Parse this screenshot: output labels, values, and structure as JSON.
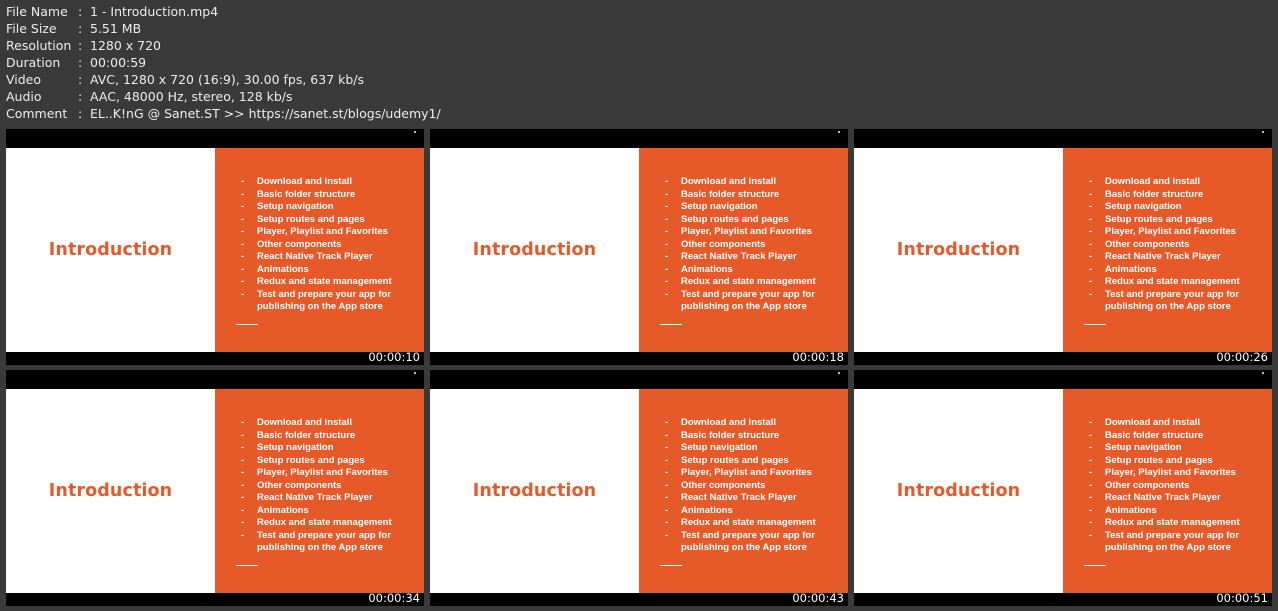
{
  "info": [
    {
      "key": "File Name",
      "value": "1 - Introduction.mp4"
    },
    {
      "key": "File Size",
      "value": "5.51 MB"
    },
    {
      "key": "Resolution",
      "value": "1280 x 720"
    },
    {
      "key": "Duration",
      "value": "00:00:59"
    },
    {
      "key": "Video",
      "value": "AVC, 1280 x 720 (16:9), 30.00 fps, 637 kb/s"
    },
    {
      "key": "Audio",
      "value": "AAC, 48000 Hz, stereo, 128 kb/s"
    },
    {
      "key": "Comment",
      "value": "EL..K!nG @ Sanet.ST >> https://sanet.st/blogs/udemy1/"
    }
  ],
  "separator": ":",
  "slide": {
    "title": "Introduction",
    "bullet": "-",
    "topics": [
      "Download and install",
      "Basic folder structure",
      "Setup navigation",
      "Setup routes and pages",
      "Player, Playlist and Favorites",
      "Other components",
      "React Native Track Player",
      "Animations",
      "Redux and state management",
      "Test and prepare your app for publishing on the App store"
    ]
  },
  "thumbnails": [
    {
      "timestamp": "00:00:10"
    },
    {
      "timestamp": "00:00:18"
    },
    {
      "timestamp": "00:00:26"
    },
    {
      "timestamp": "00:00:34"
    },
    {
      "timestamp": "00:00:43"
    },
    {
      "timestamp": "00:00:51"
    }
  ],
  "colors": {
    "background": "#3a3a3a",
    "slide_accent": "#e65a2a",
    "slide_left": "#ffffff",
    "frame": "#000000"
  }
}
